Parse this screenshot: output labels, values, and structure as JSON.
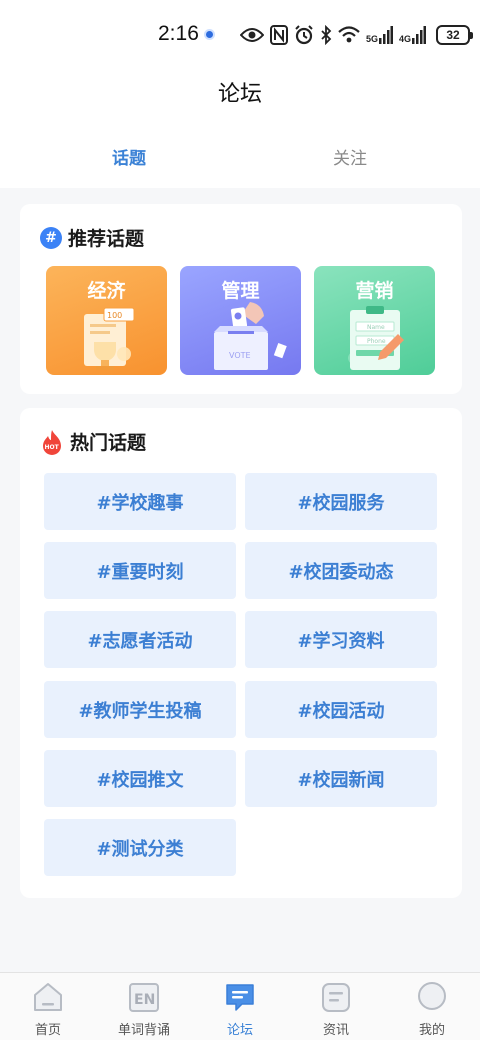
{
  "status_bar": {
    "time": "2:16",
    "net_5g": "5G",
    "net_4g": "4G",
    "battery": "32"
  },
  "header": {
    "title": "论坛",
    "tabs": [
      {
        "label": "话题",
        "active": true
      },
      {
        "label": "关注",
        "active": false
      }
    ]
  },
  "recommend": {
    "title": "推荐话题",
    "icon": "hash-icon",
    "topics": [
      {
        "label": "经济",
        "badge": "100",
        "color": "#f8a040"
      },
      {
        "label": "管理",
        "badge": "VOTE",
        "color": "#8a8ef8"
      },
      {
        "label": "营销",
        "field_1": "Name",
        "field_2": "Phone",
        "color": "#5fd4a3"
      }
    ]
  },
  "hot": {
    "title": "热门话题",
    "icon_text": "HOT",
    "tags": [
      "#学校趣事",
      "#校园服务",
      "#重要时刻",
      "#校团委动态",
      "#志愿者活动",
      "#学习资料",
      "#教师学生投稿",
      "#校园活动",
      "#校园推文",
      "#校园新闻",
      "#测试分类"
    ]
  },
  "nav": {
    "items": [
      {
        "label": "首页",
        "icon": "home-icon",
        "active": false
      },
      {
        "label": "单词背诵",
        "icon": "en-book-icon",
        "icon_text": "EN",
        "active": false
      },
      {
        "label": "论坛",
        "icon": "forum-chat-icon",
        "active": true
      },
      {
        "label": "资讯",
        "icon": "news-icon",
        "active": false
      },
      {
        "label": "我的",
        "icon": "profile-icon",
        "active": false
      }
    ]
  },
  "colors": {
    "accent": "#3b82d6",
    "tag_bg": "#e9f1fd",
    "page_bg": "#f6f7f9"
  }
}
